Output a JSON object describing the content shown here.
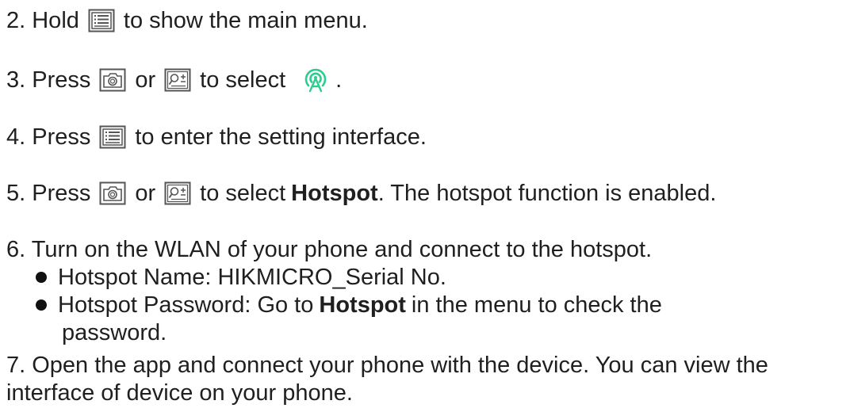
{
  "steps": {
    "s2": {
      "prefix": "2. Hold",
      "icon": "menu-icon",
      "suffix": "to show the main menu."
    },
    "s3": {
      "prefix": "3. Press",
      "icon1": "camera-icon",
      "or": "or",
      "icon2": "zoom-icon",
      "mid": "to select",
      "icon3": "hotspot-icon",
      "suffix": "."
    },
    "s4": {
      "prefix": "4. Press",
      "icon": "menu-icon",
      "suffix": "to enter the setting interface."
    },
    "s5": {
      "prefix": "5. Press",
      "icon1": "camera-icon",
      "or": "or",
      "icon2": "zoom-icon",
      "mid": "to select",
      "bold": "Hotspot",
      "suffix": ". The hotspot function is enabled."
    },
    "s6": {
      "text": "6. Turn on the WLAN of your phone and connect to the hotspot.",
      "bullets": [
        {
          "text": "Hotspot Name: HIKMICRO_Serial No."
        },
        {
          "pre": "Hotspot Password: Go to",
          "bold": "Hotspot",
          "post": "in the menu to check the",
          "cont": "password."
        }
      ]
    },
    "s7": {
      "line1": "7. Open the app and connect your phone with the device. You can view the",
      "line2": "interface of device on your phone."
    }
  },
  "colors": {
    "text": "#1f1f1f",
    "icon_stroke": "#555555",
    "hotspot_icon": "#2ecc8f"
  }
}
